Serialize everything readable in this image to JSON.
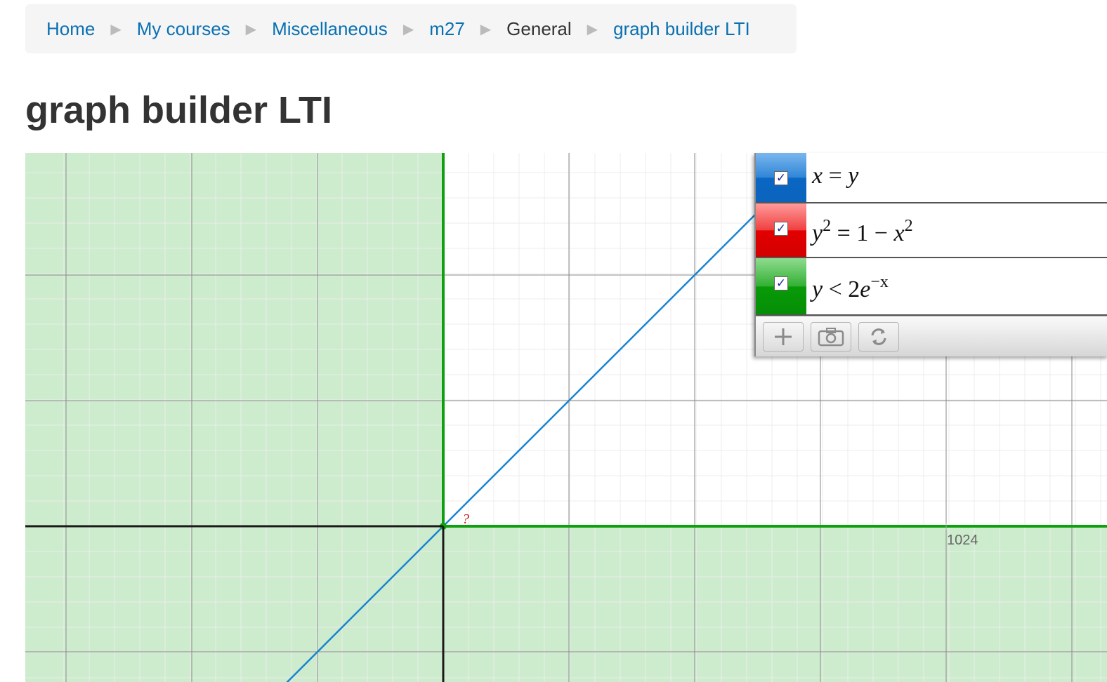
{
  "breadcrumb": {
    "items": [
      {
        "label": "Home",
        "link": true
      },
      {
        "label": "My courses",
        "link": true
      },
      {
        "label": "Miscellaneous",
        "link": true
      },
      {
        "label": "m27",
        "link": true
      },
      {
        "label": "General",
        "link": false
      },
      {
        "label": "graph builder LTI",
        "link": true
      }
    ],
    "separator": "▶"
  },
  "page": {
    "title": "graph builder LTI"
  },
  "graph": {
    "x_tick_label": "1024",
    "point_label": "?",
    "colors": {
      "inequality_fill": "#cdeccd",
      "line_x_eq_y": "#1a84d2",
      "inequality_boundary": "#0fa00f",
      "axis": "#1a1a1a",
      "grid_major": "#8a8a8a",
      "grid_minor": "#ececec"
    }
  },
  "expressions": [
    {
      "id": "x-eq-y",
      "color": "blue",
      "checked": true,
      "lhs": "x",
      "op": "=",
      "rhs": "y"
    },
    {
      "id": "circle",
      "color": "red",
      "checked": true,
      "lhs_var": "y",
      "lhs_exp": "2",
      "op": "=",
      "rhs_const": "1 −",
      "rhs_var": "x",
      "rhs_exp": "2"
    },
    {
      "id": "exp-ineq",
      "color": "green",
      "checked": true,
      "lhs": "y",
      "op": "<",
      "rhs_coef": "2",
      "rhs_var": "e",
      "rhs_exp": "−x"
    }
  ],
  "toolbar": {
    "add_icon": "plus-icon",
    "screenshot_icon": "camera-icon",
    "reset_icon": "refresh-icon",
    "checkbox_glyph": "✓"
  }
}
